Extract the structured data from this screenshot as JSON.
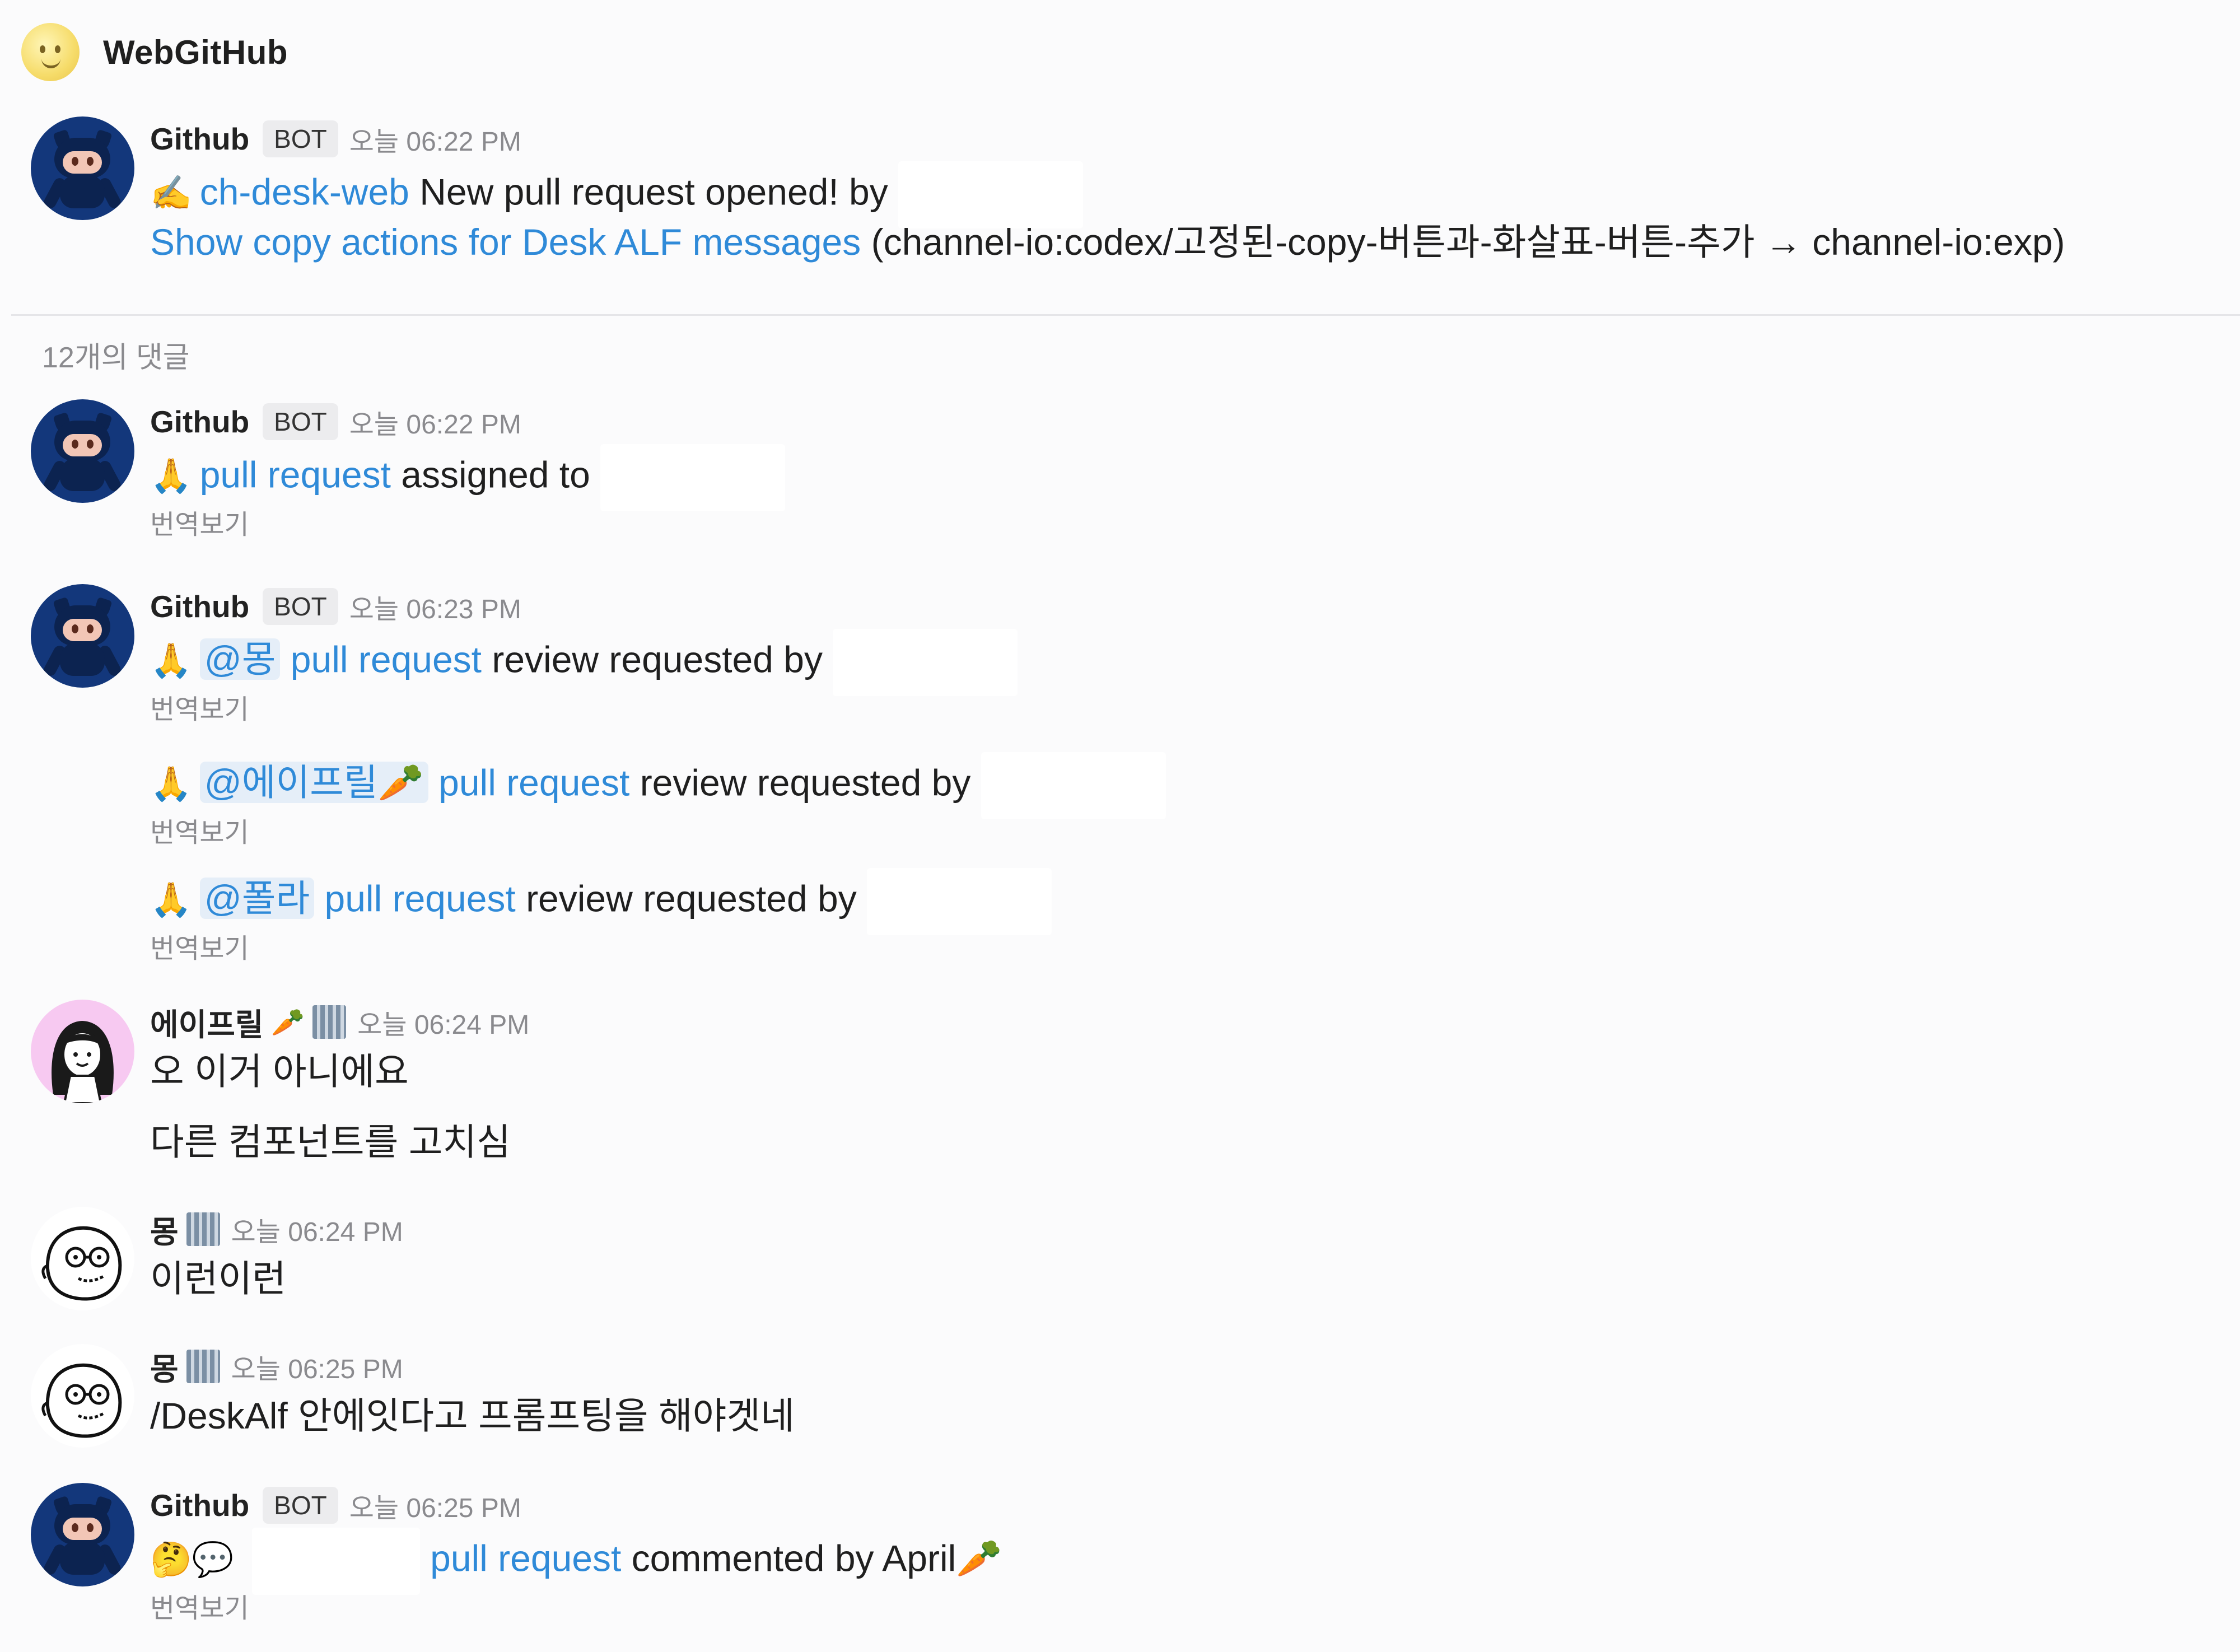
{
  "channel": {
    "name": "WebGitHub"
  },
  "comment_count": "12개의 댓글",
  "translate_label": "번역보기",
  "bot_badge": "BOT",
  "root": {
    "author": "Github",
    "time": "오늘 06:22 PM",
    "emoji": "✍️",
    "repo": "ch-desk-web",
    "text": "New pull request opened! by",
    "pr_title": "Show copy actions for Desk ALF messages",
    "branch": "(channel-io:codex/고정된-copy-버튼과-화살표-버튼-추가 → channel-io:exp)"
  },
  "m1": {
    "author": "Github",
    "time": "오늘 06:22 PM",
    "emoji": "🙏",
    "link": "pull request",
    "text": "assigned to"
  },
  "m2": {
    "author": "Github",
    "time": "오늘 06:23 PM",
    "emoji": "🙏",
    "mention": "@몽",
    "link": "pull request",
    "text": "review requested by"
  },
  "m3": {
    "emoji": "🙏",
    "mention": "@에이프릴🥕",
    "link": "pull request",
    "text": "review requested by"
  },
  "m4": {
    "emoji": "🙏",
    "mention": "@폴라",
    "link": "pull request",
    "text": "review requested by"
  },
  "m5": {
    "author": "에이프릴",
    "author_emoji": "🥕",
    "time": "오늘 06:24 PM",
    "line1": "오 이거 아니에요",
    "line2": "다른 컴포넌트를 고치심"
  },
  "m6": {
    "author": "몽",
    "time": "오늘 06:24 PM",
    "text": "이런이런"
  },
  "m7": {
    "author": "몽",
    "time": "오늘 06:25 PM",
    "text": "/DeskAlf 안에잇다고 프롬프팅을 해야겟네"
  },
  "m8": {
    "author": "Github",
    "time": "오늘 06:25 PM",
    "emoji": "🤔💬",
    "link": "pull request",
    "text": "commented by April🥕"
  }
}
